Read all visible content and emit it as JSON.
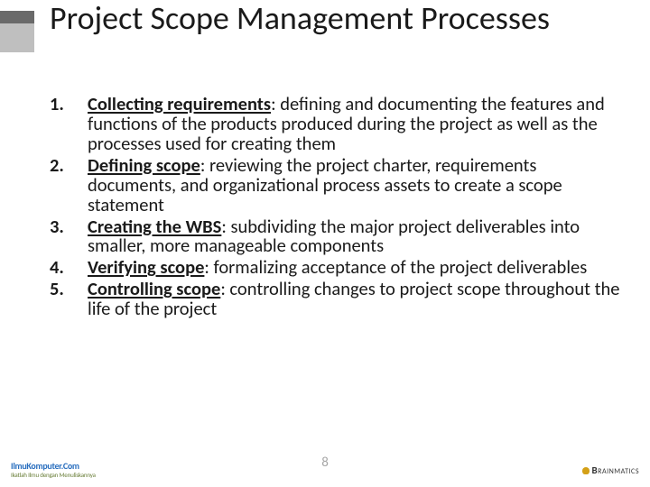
{
  "title": "Project Scope Management Processes",
  "items": [
    {
      "term": "Collecting requirements",
      "desc": ": defining and documenting the features and functions of the products produced during the project as well as the processes used for creating them"
    },
    {
      "term": "Defining scope",
      "desc": ": reviewing the project charter, requirements documents, and organizational process assets to create a scope statement"
    },
    {
      "term": "Creating the WBS",
      "desc": ": subdividing the major project deliverables into smaller, more manageable components"
    },
    {
      "term": "Verifying scope",
      "desc": ": formalizing acceptance of the project deliverables"
    },
    {
      "term": "Controlling scope",
      "desc": ": controlling changes to project scope throughout the life of the project"
    }
  ],
  "page_number": "8",
  "footer_left": {
    "top": "IlmuKomputer.Com",
    "bottom": "Ikatlah Ilmu dengan Menuliskannya"
  },
  "footer_right": {
    "brand_bold": "B",
    "brand_rest": "rainmatics"
  }
}
